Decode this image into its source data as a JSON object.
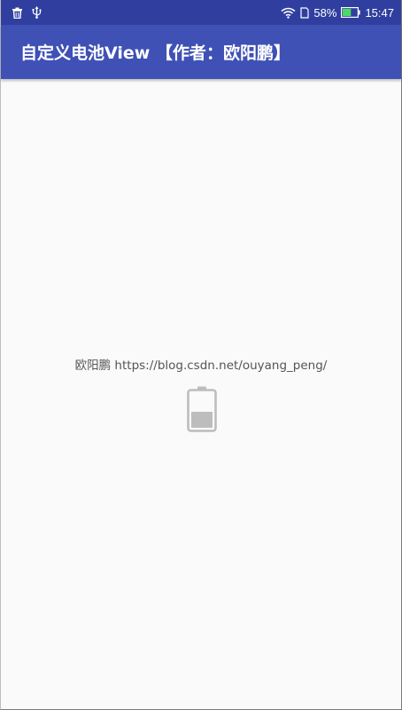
{
  "status_bar": {
    "battery_percent_text": "58%",
    "battery_level": 0.58,
    "time": "15:47",
    "icons": [
      "trash-icon",
      "usb-icon",
      "wifi-icon",
      "sim-icon",
      "battery-icon"
    ],
    "background": "#303f9f",
    "battery_fill_color": "#4cd964"
  },
  "app_bar": {
    "title": "自定义电池View 【作者：欧阳鹏】",
    "background": "#3f51b5"
  },
  "content": {
    "info_text": "欧阳鹏 https://blog.csdn.net/ouyang_peng/",
    "battery_view": {
      "level": 0.45,
      "outline_color": "#bdbdbd",
      "fill_color": "#bdbdbd"
    }
  }
}
